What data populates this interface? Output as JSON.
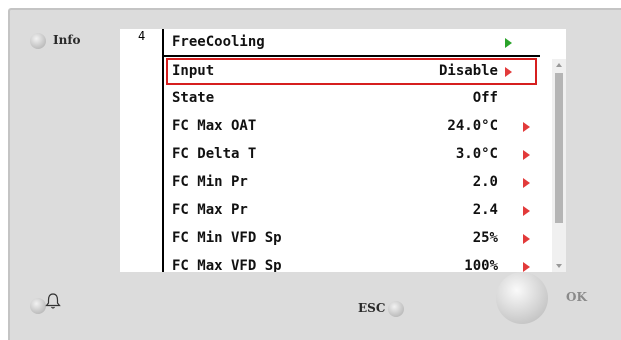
{
  "device": {
    "info_label": "Info",
    "esc_label": "ESC",
    "ok_label": "OK",
    "page_number": "4"
  },
  "menu": {
    "title": "FreeCooling",
    "rows": [
      {
        "label": "Input",
        "value": "Disable",
        "arrow": true
      },
      {
        "label": "State",
        "value": "Off",
        "arrow": false
      },
      {
        "label": "FC Max OAT",
        "value": "24.0°C",
        "arrow": true
      },
      {
        "label": "FC Delta T",
        "value": "3.0°C",
        "arrow": true
      },
      {
        "label": "FC Min Pr",
        "value": "2.0",
        "arrow": true
      },
      {
        "label": "FC Max Pr",
        "value": "2.4",
        "arrow": true
      },
      {
        "label": "FC Min VFD Sp",
        "value": "25%",
        "arrow": true
      },
      {
        "label": "FC Max VFD Sp",
        "value": "100%",
        "arrow": true
      }
    ]
  },
  "colors": {
    "selection": "#d61f1f",
    "edit_arrow": "#e23a3a",
    "nav_arrow": "#2aa32a"
  }
}
